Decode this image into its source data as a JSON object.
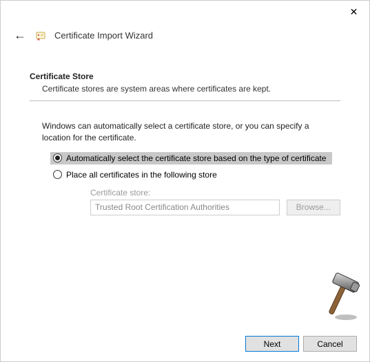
{
  "window": {
    "close_glyph": "✕",
    "back_glyph": "←",
    "title": "Certificate Import Wizard"
  },
  "section": {
    "heading": "Certificate Store",
    "description": "Certificate stores are system areas where certificates are kept."
  },
  "body": {
    "intro": "Windows can automatically select a certificate store, or you can specify a location for the certificate."
  },
  "radios": {
    "auto": "Automatically select the certificate store based on the type of certificate",
    "manual": "Place all certificates in the following store"
  },
  "store": {
    "label": "Certificate store:",
    "value": "Trusted Root Certification Authorities",
    "browse": "Browse..."
  },
  "buttons": {
    "next": "Next",
    "cancel": "Cancel"
  }
}
